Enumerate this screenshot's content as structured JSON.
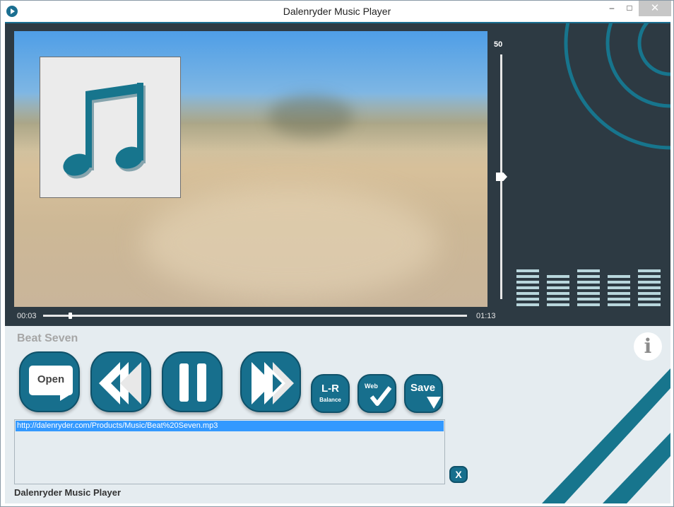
{
  "window": {
    "title": "Dalenryder Music Player",
    "controls": {
      "minimize": "–",
      "maximize": "□",
      "close": "✕"
    }
  },
  "player": {
    "time_current": "00:03",
    "time_total": "01:13",
    "seek_fraction": 0.06,
    "volume": 50,
    "volume_max": 100,
    "album_art_icon": "music-note-icon",
    "equalizer_levels": [
      7,
      6,
      7,
      6,
      7
    ],
    "equalizer_color": "#b8d6dc"
  },
  "now_playing": {
    "track_title": "Beat Seven"
  },
  "controls": {
    "open_label": "Open",
    "lr_label": "L-R",
    "lr_sub": "Balance",
    "web_label": "Web",
    "save_label": "Save",
    "info_label": "i",
    "clear_label": "X"
  },
  "playlist": {
    "items": [
      "http://dalenryder.com/Products/Music/Beat%20Seven.mp3"
    ],
    "selected_index": 0
  },
  "footer": {
    "label": "Dalenryder Music Player"
  },
  "colors": {
    "accent": "#176f8d",
    "panel_dark": "#2d3a43",
    "panel_light": "#e5ecf0",
    "selection": "#3399ff"
  }
}
